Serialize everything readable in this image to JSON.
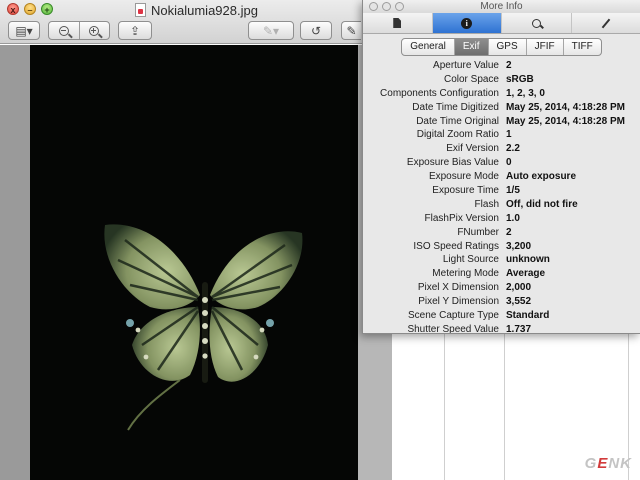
{
  "preview": {
    "title": "Nokialumia928.jpg",
    "traffic": {
      "close": "x",
      "minimize": "–",
      "zoom": "+"
    },
    "toolbar": {
      "sidebar_icon": "▤▾",
      "markup_icon": "✎▾",
      "rotate_icon": "↺",
      "share_icon": "⇪",
      "edit_icon": "✎"
    }
  },
  "inspector": {
    "title": "More Info",
    "tabs": [
      {
        "icon": "document-icon"
      },
      {
        "icon": "info-icon",
        "glyph": "i"
      },
      {
        "icon": "search-icon"
      },
      {
        "icon": "pen-icon"
      }
    ],
    "segments": [
      "General",
      "Exif",
      "GPS",
      "JFIF",
      "TIFF"
    ],
    "active_segment": "Exif",
    "rows": [
      {
        "key": "Aperture Value",
        "value": "2"
      },
      {
        "key": "Color Space",
        "value": "sRGB"
      },
      {
        "key": "Components Configuration",
        "value": "1, 2, 3, 0"
      },
      {
        "key": "Date Time Digitized",
        "value": "May 25, 2014, 4:18:28 PM"
      },
      {
        "key": "Date Time Original",
        "value": "May 25, 2014, 4:18:28 PM"
      },
      {
        "key": "Digital Zoom Ratio",
        "value": "1"
      },
      {
        "key": "Exif Version",
        "value": "2.2"
      },
      {
        "key": "Exposure Bias Value",
        "value": "0"
      },
      {
        "key": "Exposure Mode",
        "value": "Auto exposure"
      },
      {
        "key": "Exposure Time",
        "value": "1/5"
      },
      {
        "key": "Flash",
        "value": "Off, did not fire"
      },
      {
        "key": "FlashPix Version",
        "value": "1.0"
      },
      {
        "key": "FNumber",
        "value": "2"
      },
      {
        "key": "ISO Speed Ratings",
        "value": "3,200"
      },
      {
        "key": "Light Source",
        "value": "unknown"
      },
      {
        "key": "Metering Mode",
        "value": "Average"
      },
      {
        "key": "Pixel X Dimension",
        "value": "2,000"
      },
      {
        "key": "Pixel Y Dimension",
        "value": "3,552"
      },
      {
        "key": "Scene Capture Type",
        "value": "Standard"
      },
      {
        "key": "Shutter Speed Value",
        "value": "1.737"
      }
    ]
  },
  "watermark": {
    "first": "G",
    "accent": "E",
    "rest": "NK"
  }
}
